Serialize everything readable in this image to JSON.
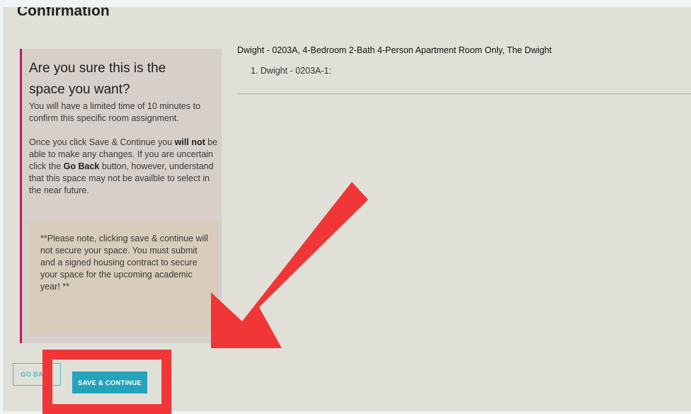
{
  "page": {
    "title": "Confirmation"
  },
  "panel": {
    "heading_line1": "Are you sure this is the",
    "heading_line2": "space you want?",
    "intro": "You will have a limited time of 10 minutes to confirm this specific room assignment.",
    "body_pre": "Once you click Save & Continue you ",
    "body_will_not_1": "will",
    "body_will_not_2": "not",
    "body_mid": " be able to make any changes. If you are uncertain click the ",
    "body_go_back": "Go Back",
    "body_post": " button, however, understand that this space may not be availble to select in the near future.",
    "note": "**Please note, clicking save & continue will not secure your space. You must submit and a signed housing contract to secure your space for the upcoming academic year! **"
  },
  "listing": {
    "title": "Dwight - 0203A, 4-Bedroom 2-Bath 4-Person Apartment Room Only, The Dwight",
    "items": [
      {
        "label": "1. Dwight - 0203A-1:"
      }
    ]
  },
  "buttons": {
    "go_back": "GO BACK",
    "save_continue": "SAVE & CONTINUE"
  },
  "annotation": {
    "color": "#f03636"
  }
}
